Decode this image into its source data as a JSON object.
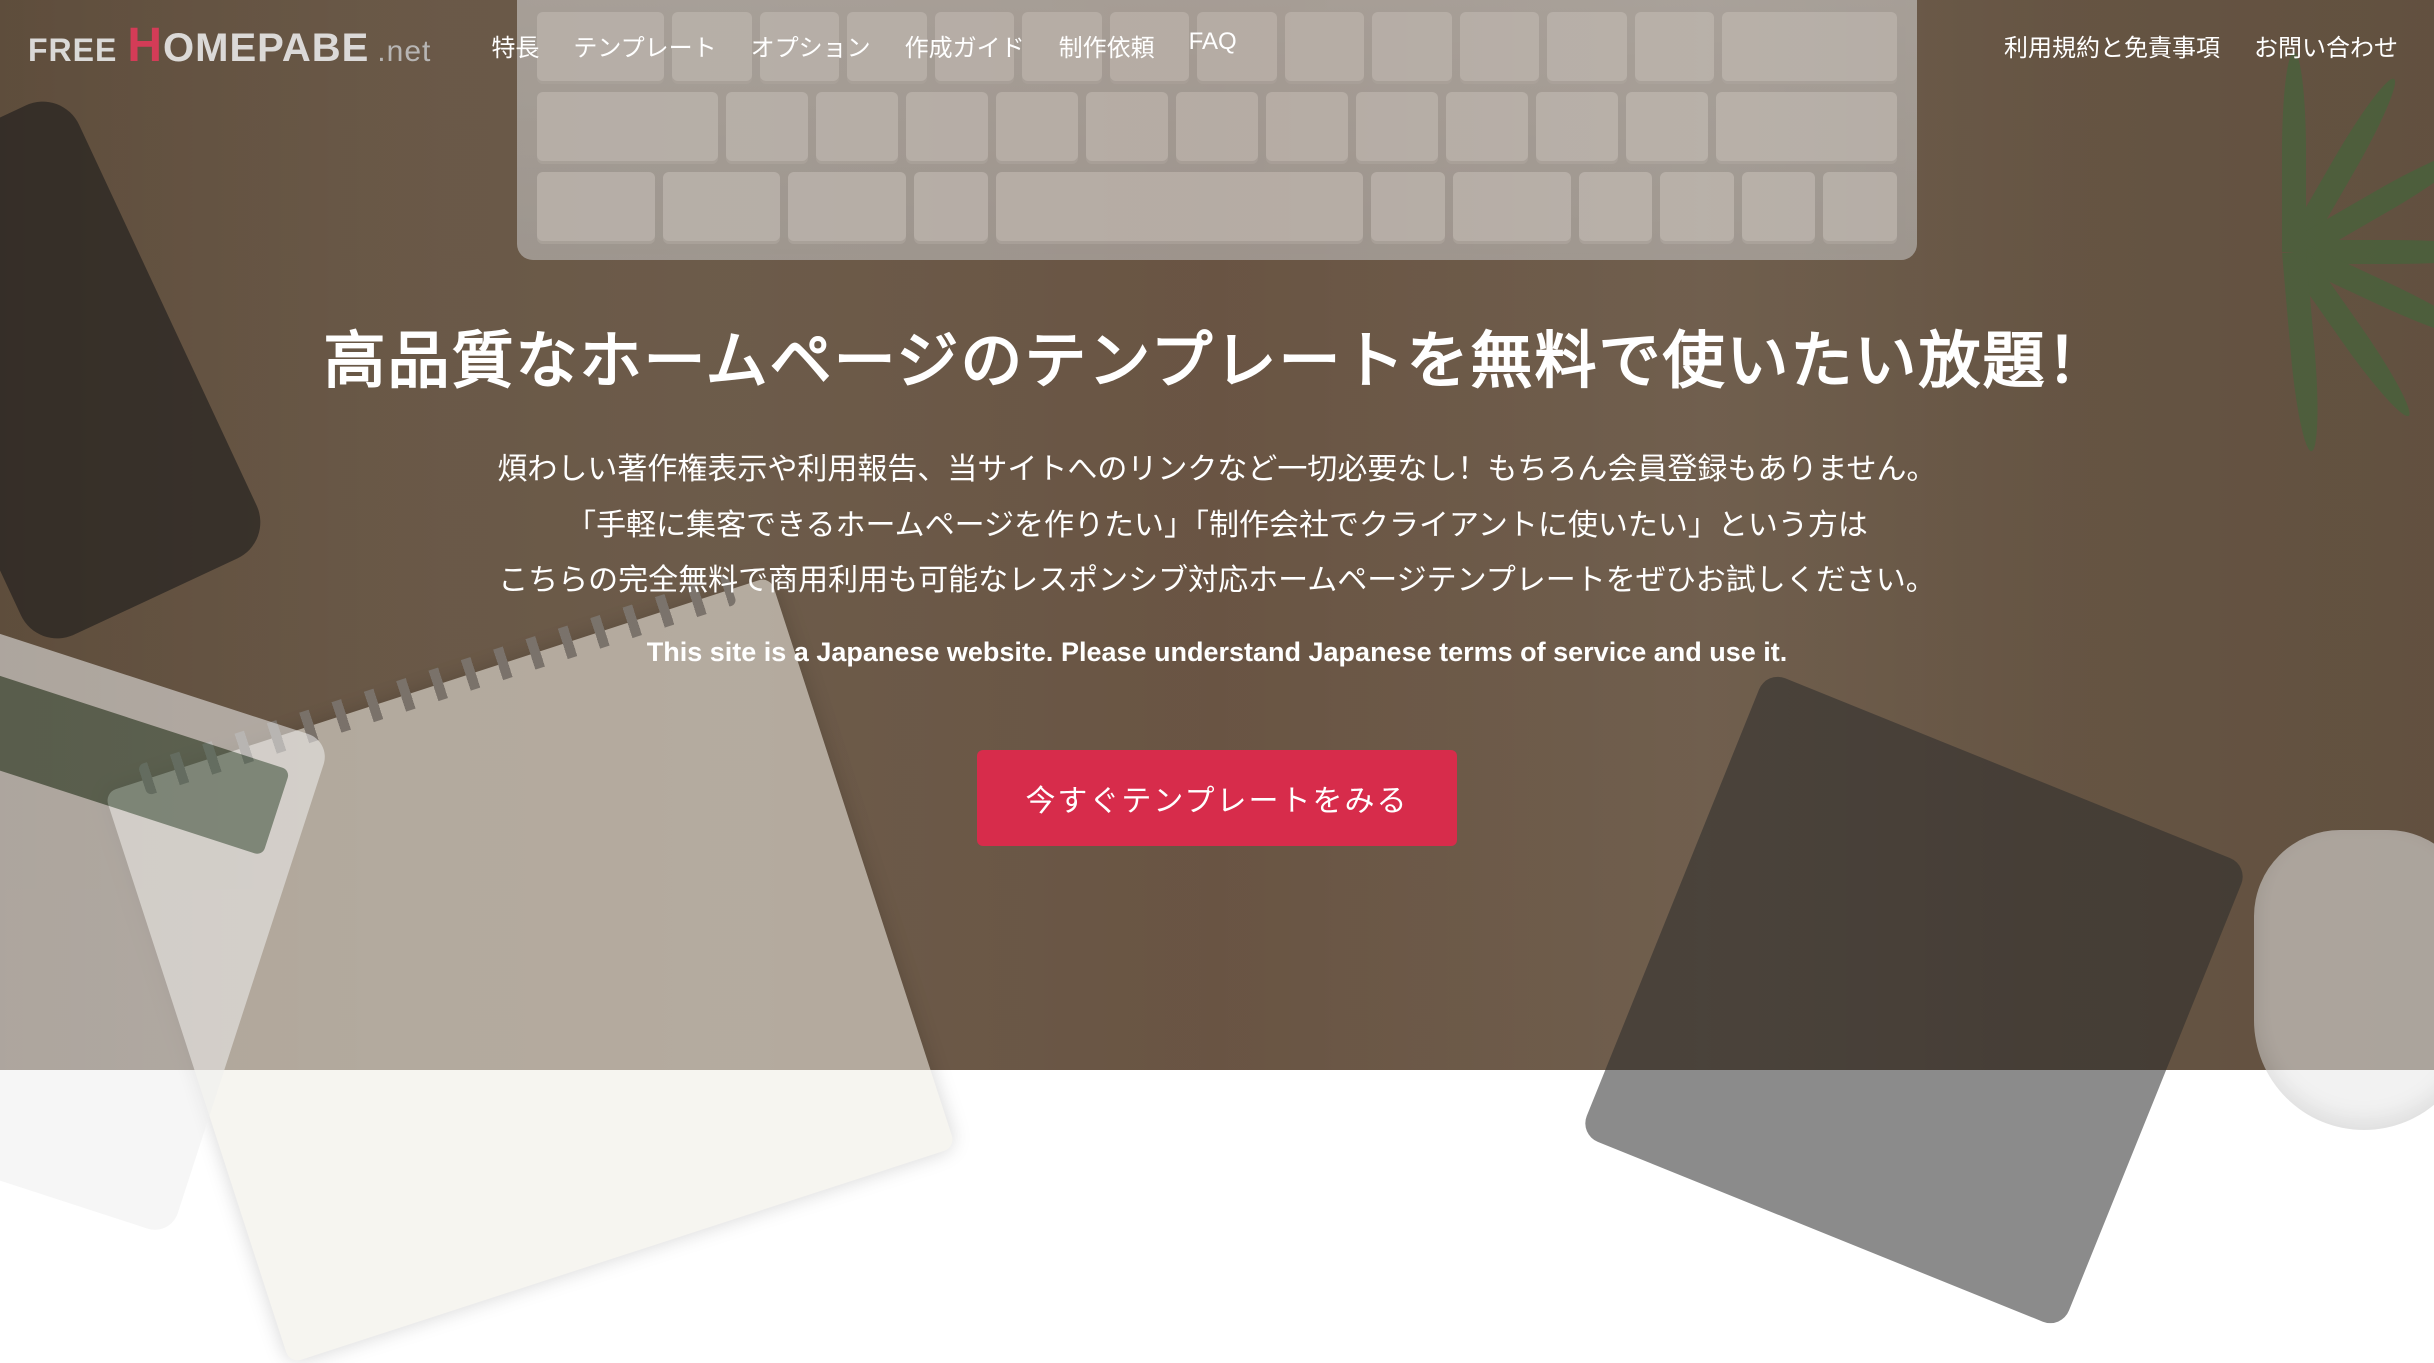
{
  "logo": {
    "free": "FREE",
    "h": "H",
    "rest": "OMEPABE",
    "suffix": ".net"
  },
  "nav": {
    "items": [
      "特長",
      "テンプレート",
      "オプション",
      "作成ガイド",
      "制作依頼",
      "FAQ"
    ],
    "right": [
      "利用規約と免責事項",
      "お問い合わせ"
    ]
  },
  "hero": {
    "title": "高品質なホームページのテンプレートを無料で使いたい放題！",
    "sub1": "煩わしい著作権表示や利用報告、当サイトへのリンクなど一切必要なし！もちろん会員登録もありません。",
    "sub2": "「手軽に集客できるホームページを作りたい」「制作会社でクライアントに使いたい」という方は",
    "sub3": "こちらの完全無料で商用利用も可能なレスポンシブ対応ホームページテンプレートをぜひお試しください。",
    "english": "This site is a Japanese website. Please understand Japanese terms of service and use it.",
    "cta": "今すぐテンプレートをみる"
  }
}
